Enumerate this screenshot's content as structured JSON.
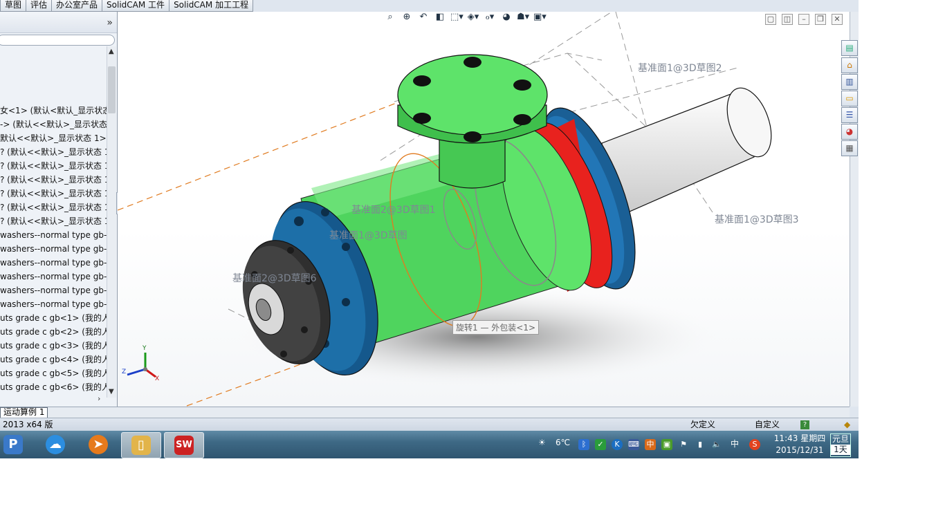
{
  "tabs": [
    "草图",
    "评估",
    "办公室产品",
    "SolidCAM 工件",
    "SolidCAM 加工工程"
  ],
  "feature_tree": {
    "expand_glyph": "»",
    "items": [
      "女<1> (默认<默认_显示状态-",
      "-> (默认<<默认>_显示状态",
      "默认<<默认>_显示状态 1>)",
      "? (默认<<默认>_显示状态 1:",
      "? (默认<<默认>_显示状态 1:",
      "? (默认<<默认>_显示状态 1:",
      "? (默认<<默认>_显示状态 1:",
      "? (默认<<默认>_显示状态 1:",
      "? (默认<<默认>_显示状态 1:",
      " washers--normal type gb-",
      " washers--normal type gb-",
      " washers--normal type gb-",
      " washers--normal type gb-",
      " washers--normal type gb-",
      " washers--normal type gb-",
      "uts grade c gb<1> (我的人-",
      "uts grade c gb<2> (我的人-",
      "uts grade c gb<3> (我的人-",
      "uts grade c gb<4> (我的人-",
      "uts grade c gb<5> (我的人-",
      "uts grade c gb<6> (我的人-"
    ]
  },
  "viewport": {
    "sketch_labels": [
      "基准面1@3D草图2",
      "基准面2@3D草图1",
      "基准面1@3D草图",
      "基准面1@3D草图3",
      "基准面2@3D草图6"
    ],
    "tooltip": "旋转1 — 外包装<1>",
    "triad": {
      "x": "X",
      "y": "Y",
      "z": "Z"
    },
    "colors": {
      "green": "#5ee36a",
      "blue": "#1d6fa8",
      "red": "#e8221e",
      "gray": "#3d3d3d",
      "shaft": "#f4f4f4"
    }
  },
  "sheet_tab": "运动算例 1",
  "status": {
    "version": "2013 x64 版",
    "state": "欠定义",
    "custom": "自定义",
    "help": "?"
  },
  "tray": {
    "weather": "6℃",
    "ime": "中",
    "time": "11:43 星期四",
    "date": "2015/12/31",
    "holiday": "元旦",
    "day": "1天"
  }
}
